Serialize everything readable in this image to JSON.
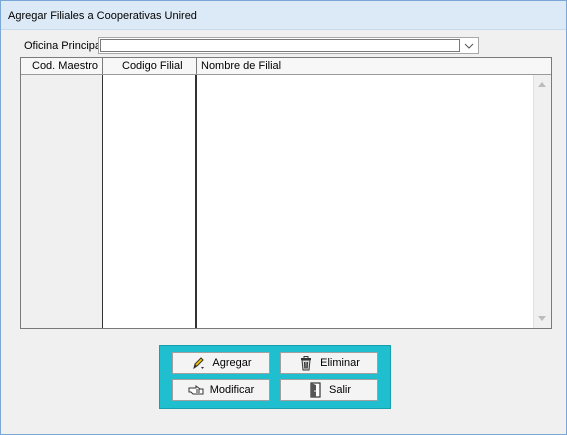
{
  "window": {
    "title": "Agregar Filiales a Cooperativas Unired"
  },
  "form": {
    "oficina_label": "Oficina Principal:",
    "oficina_value": ""
  },
  "grid": {
    "columns": [
      "Cod. Maestro",
      "Codigo Filial",
      "Nombre de Filial"
    ],
    "rows": []
  },
  "buttons": {
    "agregar": "Agregar",
    "eliminar": "Eliminar",
    "modificar": "Modificar",
    "salir": "Salir"
  },
  "colors": {
    "button_panel": "#1fbfcf",
    "titlebar": "#dce9f7"
  },
  "icons": {
    "agregar": "pencil-icon",
    "eliminar": "trash-icon",
    "modificar": "hand-pointing-icon",
    "salir": "door-exit-icon"
  }
}
